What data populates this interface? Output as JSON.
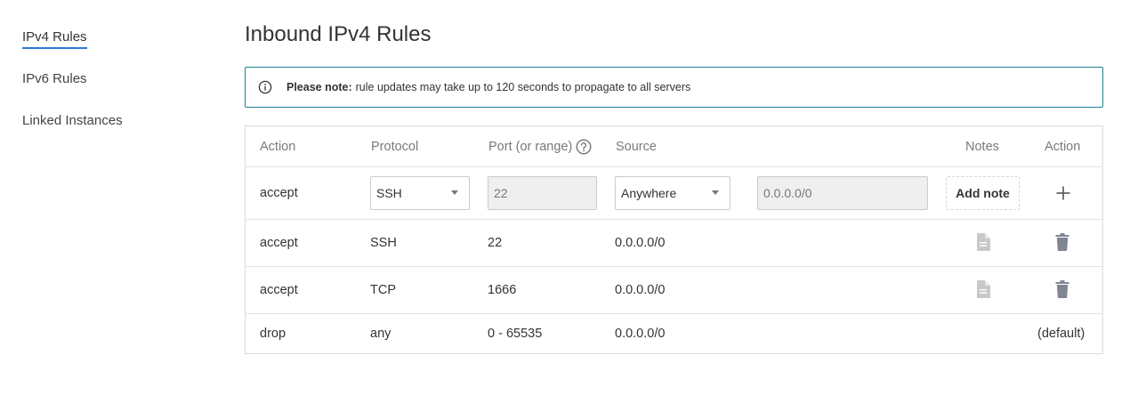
{
  "sidebar": {
    "items": [
      {
        "label": "IPv4 Rules",
        "active": true
      },
      {
        "label": "IPv6 Rules",
        "active": false
      },
      {
        "label": "Linked Instances",
        "active": false
      }
    ]
  },
  "page": {
    "title": "Inbound IPv4 Rules"
  },
  "notice": {
    "icon": "info-icon",
    "bold": "Please note:",
    "text": "rule updates may take up to 120 seconds to propagate to all servers"
  },
  "table": {
    "headers": {
      "action": "Action",
      "protocol": "Protocol",
      "port": "Port (or range)",
      "source": "Source",
      "notes": "Notes",
      "action2": "Action"
    },
    "new_rule": {
      "action": "accept",
      "protocol": "SSH",
      "port": "22",
      "source": "Anywhere",
      "source_value": "0.0.0.0/0",
      "add_note_label": "Add note",
      "add_icon": "plus-icon"
    },
    "rows": [
      {
        "action": "accept",
        "protocol": "SSH",
        "port": "22",
        "source": "0.0.0.0/0",
        "notes_icon": "document-icon",
        "action_icon": "trash-icon"
      },
      {
        "action": "accept",
        "protocol": "TCP",
        "port": "1666",
        "source": "0.0.0.0/0",
        "notes_icon": "document-icon",
        "action_icon": "trash-icon"
      },
      {
        "action": "drop",
        "protocol": "any",
        "port": "0 - 65535",
        "source": "0.0.0.0/0",
        "action_text": "(default)"
      }
    ]
  },
  "colors": {
    "accent": "#2b7bd8",
    "notice_border": "#1c7f93",
    "icon_gray": "#7f8591",
    "icon_light": "#c8c8c8"
  }
}
